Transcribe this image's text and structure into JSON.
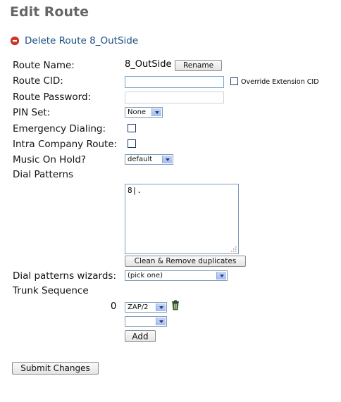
{
  "page": {
    "title": "Edit Route"
  },
  "delete_link": {
    "label": "Delete Route 8_OutSide"
  },
  "fields": {
    "route_name_label": "Route Name:",
    "route_name_value": "8_OutSide",
    "rename_button": "Rename",
    "route_cid_label": "Route CID:",
    "route_cid_value": "",
    "override_cid_label": "Override Extension CID",
    "route_password_label": "Route Password:",
    "route_password_value": "",
    "pin_set_label": "PIN Set:",
    "pin_set_value": "None",
    "emergency_label": "Emergency Dialing:",
    "intra_company_label": "Intra Company Route:",
    "moh_label": "Music On Hold?",
    "moh_value": "default",
    "dial_patterns_label": "Dial Patterns",
    "dial_patterns_value": "8|.",
    "clean_button": "Clean & Remove duplicates",
    "wizard_label": "Dial patterns wizards:",
    "wizard_value": "(pick one)",
    "trunk_sequence_label": "Trunk Sequence",
    "trunk_index": "0",
    "trunk_value": "ZAP/2",
    "trunk_empty_value": "",
    "add_button": "Add",
    "submit_button": "Submit Changes"
  },
  "colors": {
    "title": "#666666",
    "link": "#1a4f85",
    "delete_icon": "#d43a2c"
  }
}
